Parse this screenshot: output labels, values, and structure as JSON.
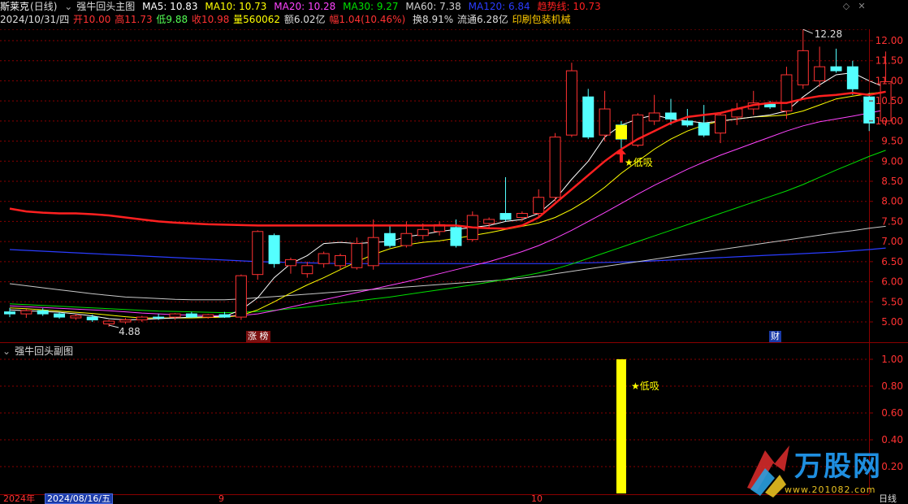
{
  "header": {
    "stock_name": "斯莱克",
    "period": "(日线)",
    "indicator_name": "强牛回头主图",
    "ma5": "MA5: 10.83",
    "ma10": "MA10: 10.73",
    "ma20": "MA20: 10.28",
    "ma30": "MA30: 9.27",
    "ma60": "MA60: 7.38",
    "ma120": "MA120: 6.84",
    "trend": "趋势线: 10.73",
    "date": "2024/10/31/四",
    "open": "开10.00",
    "high": "高11.73",
    "low": "低9.88",
    "close": "收10.98",
    "volume": "量560062",
    "amount": "额6.02亿",
    "change": "幅1.04(10.46%)",
    "turnover": "换8.91%",
    "float": "流通6.28亿",
    "industry": "印刷包装机械"
  },
  "sub_panel": {
    "title": "强牛回头副图"
  },
  "bottom_axis": {
    "year": "2024年",
    "selected_date": "2024/08/16/五",
    "month_sep": "9",
    "month_oct": "10",
    "period_label": "日线"
  },
  "badges": {
    "limit_up": "涨 榜",
    "finance": "财"
  },
  "watermark": {
    "brand": "万股网",
    "url": "www.201082.com"
  },
  "colors": {
    "background": "#000000",
    "up": "#ff3232",
    "down": "#54ffff",
    "trend": "#ff2020",
    "ma5": "#ffffff",
    "ma10": "#ffff00",
    "ma20": "#ff44ff",
    "ma30": "#00e000",
    "ma60": "#c8c8c8",
    "ma120": "#2a3cff",
    "signal_bar": "#ffff00",
    "gridline": "#8a0000"
  },
  "chart_data": [
    {
      "type": "candlestick",
      "title": "强牛回头主图",
      "ylim": [
        4.6,
        12.4
      ],
      "yticks": [
        5.0,
        5.5,
        6.0,
        6.5,
        7.0,
        7.5,
        8.0,
        8.5,
        9.0,
        9.5,
        10.0,
        10.5,
        11.0,
        11.5,
        12.0
      ],
      "candles": [
        {
          "o": 5.25,
          "h": 5.35,
          "l": 5.12,
          "c": 5.2
        },
        {
          "o": 5.2,
          "h": 5.32,
          "l": 5.1,
          "c": 5.28
        },
        {
          "o": 5.28,
          "h": 5.34,
          "l": 5.15,
          "c": 5.2
        },
        {
          "o": 5.2,
          "h": 5.25,
          "l": 5.08,
          "c": 5.12
        },
        {
          "o": 5.1,
          "h": 5.2,
          "l": 5.05,
          "c": 5.15
        },
        {
          "o": 5.12,
          "h": 5.18,
          "l": 5.0,
          "c": 5.05
        },
        {
          "o": 4.95,
          "h": 5.05,
          "l": 4.88,
          "c": 5.02
        },
        {
          "o": 5.0,
          "h": 5.1,
          "l": 4.95,
          "c": 5.05
        },
        {
          "o": 5.05,
          "h": 5.15,
          "l": 5.0,
          "c": 5.12
        },
        {
          "o": 5.12,
          "h": 5.2,
          "l": 5.05,
          "c": 5.1
        },
        {
          "o": 5.12,
          "h": 5.22,
          "l": 5.05,
          "c": 5.2
        },
        {
          "o": 5.2,
          "h": 5.25,
          "l": 5.1,
          "c": 5.12
        },
        {
          "o": 5.12,
          "h": 5.2,
          "l": 5.08,
          "c": 5.18
        },
        {
          "o": 5.18,
          "h": 5.25,
          "l": 5.1,
          "c": 5.12
        },
        {
          "o": 5.12,
          "h": 6.18,
          "l": 5.05,
          "c": 6.15
        },
        {
          "o": 6.18,
          "h": 7.28,
          "l": 6.05,
          "c": 7.25
        },
        {
          "o": 7.15,
          "h": 7.2,
          "l": 6.35,
          "c": 6.45
        },
        {
          "o": 6.4,
          "h": 6.6,
          "l": 6.2,
          "c": 6.55
        },
        {
          "o": 6.2,
          "h": 6.5,
          "l": 6.1,
          "c": 6.4
        },
        {
          "o": 6.45,
          "h": 6.75,
          "l": 6.35,
          "c": 6.7
        },
        {
          "o": 6.4,
          "h": 6.7,
          "l": 6.3,
          "c": 6.65
        },
        {
          "o": 6.35,
          "h": 7.1,
          "l": 6.3,
          "c": 6.95
        },
        {
          "o": 6.4,
          "h": 7.55,
          "l": 6.3,
          "c": 7.1
        },
        {
          "o": 7.2,
          "h": 7.4,
          "l": 6.85,
          "c": 6.9
        },
        {
          "o": 6.9,
          "h": 7.5,
          "l": 6.85,
          "c": 7.2
        },
        {
          "o": 7.15,
          "h": 7.45,
          "l": 7.05,
          "c": 7.3
        },
        {
          "o": 7.25,
          "h": 7.5,
          "l": 7.15,
          "c": 7.42
        },
        {
          "o": 7.35,
          "h": 7.55,
          "l": 6.85,
          "c": 6.9
        },
        {
          "o": 7.05,
          "h": 7.75,
          "l": 7.0,
          "c": 7.65
        },
        {
          "o": 7.45,
          "h": 7.6,
          "l": 7.35,
          "c": 7.55
        },
        {
          "o": 7.7,
          "h": 8.6,
          "l": 7.5,
          "c": 7.55
        },
        {
          "o": 7.6,
          "h": 7.75,
          "l": 7.5,
          "c": 7.7
        },
        {
          "o": 7.7,
          "h": 8.3,
          "l": 7.6,
          "c": 8.1
        },
        {
          "o": 8.1,
          "h": 9.7,
          "l": 8.0,
          "c": 9.6
        },
        {
          "o": 9.65,
          "h": 11.45,
          "l": 9.6,
          "c": 11.25
        },
        {
          "o": 10.6,
          "h": 10.8,
          "l": 9.55,
          "c": 9.6
        },
        {
          "o": 9.65,
          "h": 10.75,
          "l": 9.5,
          "c": 10.3
        },
        {
          "o": 9.9,
          "h": 10.0,
          "l": 9.25,
          "c": 9.55
        },
        {
          "o": 9.4,
          "h": 10.2,
          "l": 9.35,
          "c": 10.15
        },
        {
          "o": 10.0,
          "h": 10.65,
          "l": 9.9,
          "c": 10.2
        },
        {
          "o": 10.2,
          "h": 10.55,
          "l": 9.9,
          "c": 10.05
        },
        {
          "o": 10.0,
          "h": 10.3,
          "l": 9.85,
          "c": 9.9
        },
        {
          "o": 9.95,
          "h": 10.4,
          "l": 9.6,
          "c": 9.65
        },
        {
          "o": 9.7,
          "h": 10.2,
          "l": 9.45,
          "c": 10.15
        },
        {
          "o": 10.1,
          "h": 10.45,
          "l": 9.9,
          "c": 10.3
        },
        {
          "o": 10.3,
          "h": 10.75,
          "l": 10.15,
          "c": 10.45
        },
        {
          "o": 10.45,
          "h": 10.5,
          "l": 10.3,
          "c": 10.35
        },
        {
          "o": 10.25,
          "h": 11.35,
          "l": 10.05,
          "c": 11.15
        },
        {
          "o": 10.9,
          "h": 12.28,
          "l": 10.8,
          "c": 11.75
        },
        {
          "o": 11.0,
          "h": 11.85,
          "l": 10.85,
          "c": 11.35
        },
        {
          "o": 11.35,
          "h": 11.8,
          "l": 11.2,
          "c": 11.25
        },
        {
          "o": 11.35,
          "h": 11.5,
          "l": 10.65,
          "c": 10.8
        },
        {
          "o": 10.6,
          "h": 10.7,
          "l": 9.75,
          "c": 9.95
        },
        {
          "o": 10.0,
          "h": 11.73,
          "l": 9.88,
          "c": 10.98
        }
      ],
      "trend_line": [
        7.82,
        7.75,
        7.72,
        7.7,
        7.7,
        7.68,
        7.65,
        7.6,
        7.55,
        7.5,
        7.47,
        7.45,
        7.43,
        7.42,
        7.41,
        7.4,
        7.4,
        7.4,
        7.4,
        7.4,
        7.4,
        7.4,
        7.4,
        7.4,
        7.4,
        7.4,
        7.4,
        7.4,
        7.35,
        7.33,
        7.32,
        7.4,
        7.6,
        7.95,
        8.3,
        8.65,
        9.0,
        9.3,
        9.55,
        9.75,
        9.95,
        10.1,
        10.15,
        10.2,
        10.3,
        10.4,
        10.45,
        10.45,
        10.55,
        10.62,
        10.65,
        10.7,
        10.65,
        10.73
      ],
      "ma5": [
        5.3,
        5.28,
        5.26,
        5.24,
        5.2,
        5.15,
        5.08,
        5.05,
        5.06,
        5.08,
        5.1,
        5.12,
        5.13,
        5.14,
        5.3,
        5.6,
        6.1,
        6.45,
        6.65,
        6.95,
        6.98,
        6.95,
        6.98,
        7.0,
        7.12,
        7.18,
        7.25,
        7.3,
        7.35,
        7.4,
        7.5,
        7.55,
        7.7,
        8.05,
        8.55,
        9.0,
        9.6,
        9.9,
        10.05,
        10.15,
        10.05,
        10.0,
        9.95,
        10.0,
        10.05,
        10.1,
        10.15,
        10.25,
        10.6,
        10.9,
        11.15,
        11.2,
        11.0,
        10.83
      ],
      "ma10": [
        5.35,
        5.33,
        5.3,
        5.27,
        5.24,
        5.21,
        5.17,
        5.13,
        5.1,
        5.1,
        5.1,
        5.1,
        5.11,
        5.12,
        5.16,
        5.3,
        5.5,
        5.72,
        5.92,
        6.1,
        6.3,
        6.5,
        6.68,
        6.82,
        6.92,
        6.98,
        7.02,
        7.08,
        7.15,
        7.22,
        7.3,
        7.38,
        7.46,
        7.6,
        7.8,
        8.05,
        8.35,
        8.7,
        9.0,
        9.3,
        9.55,
        9.75,
        9.9,
        10.0,
        10.05,
        10.1,
        10.12,
        10.15,
        10.25,
        10.4,
        10.55,
        10.62,
        10.68,
        10.73
      ],
      "ma20": [
        5.4,
        5.38,
        5.36,
        5.34,
        5.32,
        5.3,
        5.28,
        5.25,
        5.22,
        5.2,
        5.18,
        5.17,
        5.16,
        5.15,
        5.16,
        5.2,
        5.28,
        5.37,
        5.46,
        5.55,
        5.64,
        5.73,
        5.82,
        5.91,
        6.0,
        6.1,
        6.2,
        6.3,
        6.4,
        6.5,
        6.62,
        6.75,
        6.9,
        7.08,
        7.28,
        7.5,
        7.72,
        7.95,
        8.18,
        8.4,
        8.6,
        8.8,
        8.98,
        9.15,
        9.3,
        9.45,
        9.6,
        9.75,
        9.88,
        9.98,
        10.05,
        10.12,
        10.2,
        10.28
      ],
      "ma30": [
        5.45,
        5.43,
        5.41,
        5.39,
        5.37,
        5.35,
        5.33,
        5.31,
        5.29,
        5.27,
        5.26,
        5.25,
        5.24,
        5.23,
        5.24,
        5.26,
        5.29,
        5.33,
        5.37,
        5.42,
        5.47,
        5.52,
        5.57,
        5.62,
        5.68,
        5.74,
        5.8,
        5.86,
        5.92,
        5.99,
        6.06,
        6.14,
        6.22,
        6.32,
        6.44,
        6.58,
        6.72,
        6.86,
        7.0,
        7.14,
        7.28,
        7.42,
        7.56,
        7.7,
        7.84,
        7.98,
        8.12,
        8.26,
        8.42,
        8.6,
        8.78,
        8.95,
        9.12,
        9.27
      ],
      "ma60": [
        5.95,
        5.9,
        5.85,
        5.8,
        5.75,
        5.7,
        5.66,
        5.62,
        5.6,
        5.58,
        5.56,
        5.55,
        5.55,
        5.55,
        5.57,
        5.6,
        5.63,
        5.66,
        5.69,
        5.72,
        5.75,
        5.78,
        5.81,
        5.84,
        5.87,
        5.9,
        5.93,
        5.96,
        5.99,
        6.02,
        6.05,
        6.09,
        6.14,
        6.2,
        6.26,
        6.32,
        6.38,
        6.44,
        6.5,
        6.56,
        6.62,
        6.68,
        6.74,
        6.8,
        6.86,
        6.92,
        6.98,
        7.04,
        7.1,
        7.16,
        7.22,
        7.27,
        7.33,
        7.38
      ],
      "ma120": [
        6.8,
        6.78,
        6.76,
        6.74,
        6.72,
        6.7,
        6.68,
        6.66,
        6.64,
        6.62,
        6.6,
        6.58,
        6.56,
        6.54,
        6.52,
        6.5,
        6.49,
        6.48,
        6.47,
        6.46,
        6.45,
        6.45,
        6.45,
        6.45,
        6.45,
        6.45,
        6.45,
        6.45,
        6.45,
        6.45,
        6.45,
        6.45,
        6.45,
        6.45,
        6.46,
        6.47,
        6.48,
        6.49,
        6.5,
        6.52,
        6.54,
        6.56,
        6.58,
        6.6,
        6.62,
        6.64,
        6.66,
        6.68,
        6.7,
        6.72,
        6.74,
        6.77,
        6.8,
        6.84
      ],
      "annotations": [
        {
          "text": "12.28",
          "kind": "high"
        },
        {
          "text": "4.88",
          "kind": "low"
        },
        {
          "text": "★低吸",
          "kind": "signal"
        }
      ]
    },
    {
      "type": "bar",
      "title": "强牛回头副图",
      "ylim": [
        0,
        1.05
      ],
      "yticks": [
        0.2,
        0.4,
        0.6,
        0.8,
        1.0
      ],
      "values_index": 36,
      "value": 1.0,
      "label": "★低吸"
    }
  ]
}
